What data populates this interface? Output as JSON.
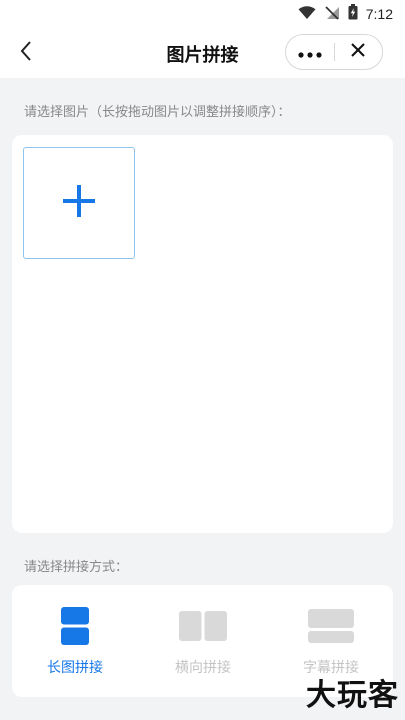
{
  "status_bar": {
    "time": "7:12"
  },
  "nav": {
    "title": "图片拼接"
  },
  "labels": {
    "select_images": "请选择图片（长按拖动图片以调整拼接顺序）：",
    "select_mode": "请选择拼接方式："
  },
  "modes": [
    {
      "label": "长图拼接",
      "active": true
    },
    {
      "label": "横向拼接",
      "active": false
    },
    {
      "label": "字幕拼接",
      "active": false
    }
  ],
  "colors": {
    "accent": "#1677e6",
    "inactive": "#d9d9d9",
    "background": "#f2f3f5"
  },
  "watermark": "大玩客"
}
